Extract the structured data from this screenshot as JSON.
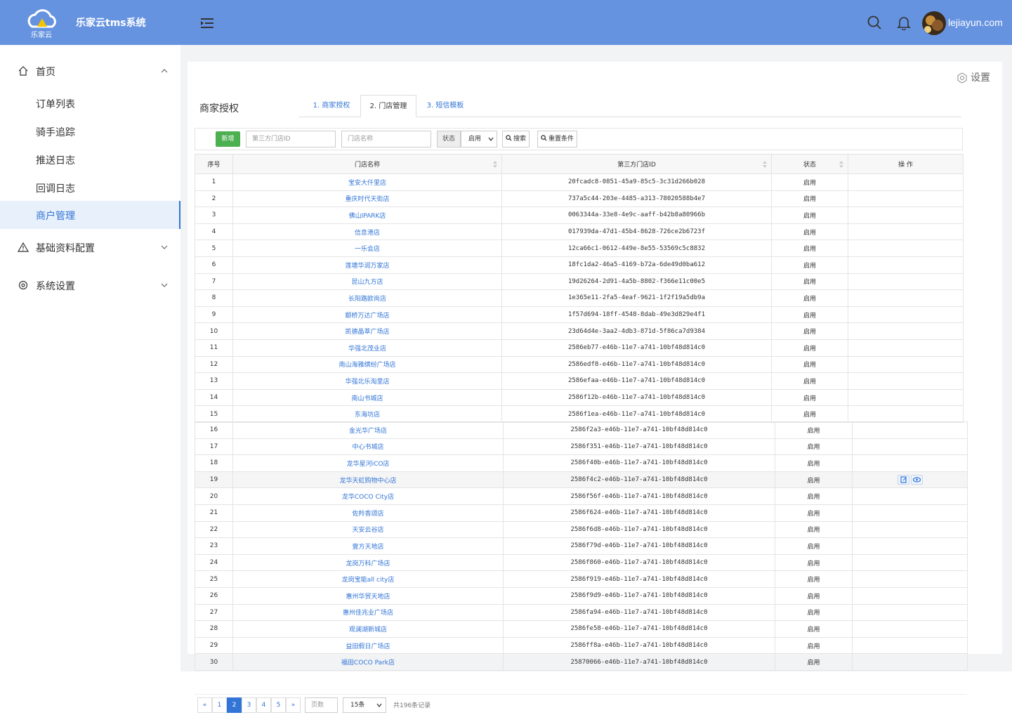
{
  "app": {
    "logo_text": "乐家云",
    "title": "乐家云tms系统",
    "username": "lejiayun.com"
  },
  "sidebar": {
    "home": "首页",
    "sub_items": [
      {
        "label": "订单列表"
      },
      {
        "label": "骑手追踪"
      },
      {
        "label": "推送日志"
      },
      {
        "label": "回调日志"
      },
      {
        "label": "商户管理",
        "active": true
      }
    ],
    "basic_config": "基础资料配置",
    "system_settings": "系统设置"
  },
  "panel": {
    "settings_label": "设置",
    "page_title": "商家授权",
    "tabs": [
      {
        "label": "1. 商家授权"
      },
      {
        "label": "2. 门店管理",
        "active": true
      },
      {
        "label": "3. 短信模板"
      }
    ]
  },
  "toolbar": {
    "new_label": "新增",
    "store_id_placeholder": "第三方门店ID",
    "store_name_placeholder": "门店名称",
    "status_label": "状态",
    "status_value": "启用",
    "search_label": "搜索",
    "reset_label": "重置条件"
  },
  "table": {
    "headers": {
      "index": "序号",
      "name": "门店名称",
      "store_id": "第三方门店ID",
      "status": "状态",
      "ops": "操 作"
    },
    "rows": [
      [
        "1",
        "宝安大仟里店",
        "20fcadc8-0851-45a9-85c5-3c31d266b028",
        "启用"
      ],
      [
        "2",
        "重庆时代天街店",
        "737a5c44-203e-4485-a313-78020588b4e7",
        "启用"
      ],
      [
        "3",
        "佛山IPARK店",
        "0063344a-33e8-4e9c-aaff-b42b8a80966b",
        "启用"
      ],
      [
        "4",
        "信息港店",
        "017939da-47d1-45b4-8628-726ce2b6723f",
        "启用"
      ],
      [
        "5",
        "一乐会店",
        "12ca66c1-0612-449e-8e55-53569c5c8832",
        "启用"
      ],
      [
        "6",
        "莲塘华润万家店",
        "18fc1da2-46a5-4169-b72a-6de49d0ba612",
        "启用"
      ],
      [
        "7",
        "昆山九方店",
        "19d26264-2d91-4a5b-8802-f366e11c00e5",
        "启用"
      ],
      [
        "8",
        "长阳路欧尚店",
        "1e365e11-2fa5-4eaf-9621-1f2f19a5db9a",
        "启用"
      ],
      [
        "9",
        "颛桥万达广场店",
        "1f57d694-18ff-4548-8dab-49e3d829e4f1",
        "启用"
      ],
      [
        "10",
        "凯德晶萃广场店",
        "23d64d4e-3aa2-4db3-871d-5f86ca7d9384",
        "启用"
      ],
      [
        "11",
        "华强北茂业店",
        "2586eb77-e46b-11e7-a741-10bf48d814c0",
        "启用"
      ],
      [
        "12",
        "南山海雅缤纷广场店",
        "2586edf8-e46b-11e7-a741-10bf48d814c0",
        "启用"
      ],
      [
        "13",
        "华强北乐淘里店",
        "2586efaa-e46b-11e7-a741-10bf48d814c0",
        "启用"
      ],
      [
        "14",
        "南山书城店",
        "2586f12b-e46b-11e7-a741-10bf48d814c0",
        "启用"
      ],
      [
        "15",
        "东海坊店",
        "2586f1ea-e46b-11e7-a741-10bf48d814c0",
        "启用"
      ]
    ],
    "rows2": [
      [
        "16",
        "金光华广场店",
        "2586f2a3-e46b-11e7-a741-10bf48d814c0",
        "启用"
      ],
      [
        "17",
        "中心书城店",
        "2586f351-e46b-11e7-a741-10bf48d814c0",
        "启用"
      ],
      [
        "18",
        "龙华星河iCO店",
        "2586f40b-e46b-11e7-a741-10bf48d814c0",
        "启用"
      ],
      [
        "19",
        "龙华天虹购物中心店",
        "2586f4c2-e46b-11e7-a741-10bf48d814c0",
        "启用"
      ],
      [
        "20",
        "龙华COCO City店",
        "2586f56f-e46b-11e7-a741-10bf48d814c0",
        "启用"
      ],
      [
        "21",
        "佐羚香颂店",
        "2586f624-e46b-11e7-a741-10bf48d814c0",
        "启用"
      ],
      [
        "22",
        "天安云谷店",
        "2586f6d8-e46b-11e7-a741-10bf48d814c0",
        "启用"
      ],
      [
        "23",
        "壹方天地店",
        "2586f79d-e46b-11e7-a741-10bf48d814c0",
        "启用"
      ],
      [
        "24",
        "龙岗万科广场店",
        "2586f860-e46b-11e7-a741-10bf48d814c0",
        "启用"
      ],
      [
        "25",
        "龙岗宝能all city店",
        "2586f919-e46b-11e7-a741-10bf48d814c0",
        "启用"
      ],
      [
        "26",
        "惠州华贸天地店",
        "2586f9d9-e46b-11e7-a741-10bf48d814c0",
        "启用"
      ],
      [
        "27",
        "惠州佳兆业广场店",
        "2586fa94-e46b-11e7-a741-10bf48d814c0",
        "启用"
      ],
      [
        "28",
        "观澜湖新城店",
        "2586fe58-e46b-11e7-a741-10bf48d814c0",
        "启用"
      ],
      [
        "29",
        "益田假日广场店",
        "2586ff8a-e46b-11e7-a741-10bf48d814c0",
        "启用"
      ],
      [
        "30",
        "福田COCO Park店",
        "25870066-e46b-11e7-a741-10bf48d814c0",
        "启用"
      ]
    ]
  },
  "pagination": {
    "prev": "«",
    "pages": [
      "1",
      "2",
      "3",
      "4",
      "5"
    ],
    "current": "2",
    "next": "»",
    "page_input_placeholder": "页数",
    "page_size": "15条",
    "total": "共196条记录"
  },
  "colors": {
    "topbar": "#6693e0",
    "accent": "#3275d6",
    "new_button": "#4caf50"
  }
}
